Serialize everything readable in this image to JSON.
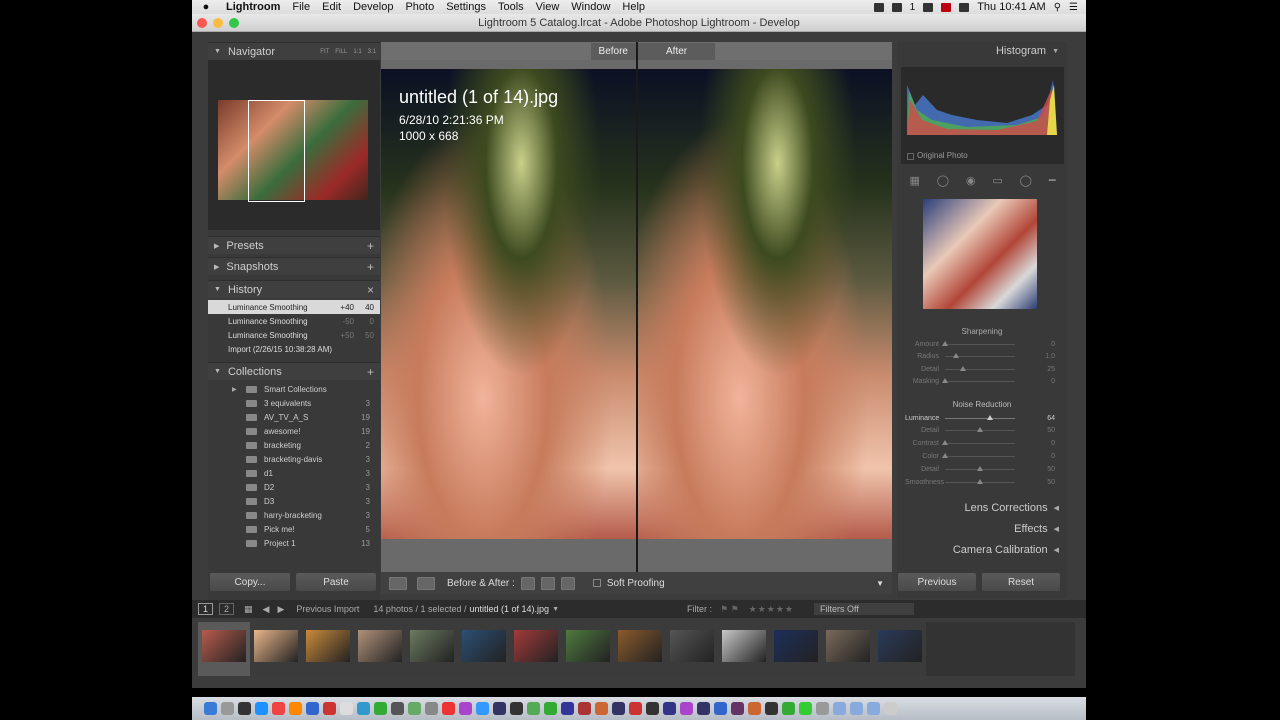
{
  "menubar": {
    "app": "Lightroom",
    "items": [
      "File",
      "Edit",
      "Develop",
      "Photo",
      "Settings",
      "Tools",
      "View",
      "Window",
      "Help"
    ],
    "clock": "Thu 10:41 AM",
    "badge": "1"
  },
  "window": {
    "title": "Lightroom 5 Catalog.lrcat - Adobe Photoshop Lightroom - Develop"
  },
  "left": {
    "navigator": {
      "title": "Navigator",
      "options": [
        "FIT",
        "FILL",
        "1:1",
        "3:1"
      ]
    },
    "presets": "Presets",
    "snapshots": "Snapshots",
    "history": {
      "title": "History",
      "items": [
        {
          "label": "Luminance Smoothing",
          "delta": "+40",
          "value": "40"
        },
        {
          "label": "Luminance Smoothing",
          "delta": "-50",
          "value": "0"
        },
        {
          "label": "Luminance Smoothing",
          "delta": "+50",
          "value": "50"
        },
        {
          "label": "Import (2/26/15 10:38:28 AM)",
          "delta": "",
          "value": ""
        }
      ]
    },
    "collections": {
      "title": "Collections",
      "items": [
        {
          "label": "Smart Collections",
          "count": ""
        },
        {
          "label": "3 equivalents",
          "count": "3"
        },
        {
          "label": "AV_TV_A_S",
          "count": "19"
        },
        {
          "label": "awesome!",
          "count": "19"
        },
        {
          "label": "bracketing",
          "count": "2"
        },
        {
          "label": "bracketing-davis",
          "count": "3"
        },
        {
          "label": "d1",
          "count": "3"
        },
        {
          "label": "D2",
          "count": "3"
        },
        {
          "label": "D3",
          "count": "3"
        },
        {
          "label": "harry-bracketing",
          "count": "3"
        },
        {
          "label": "Pick me!",
          "count": "5"
        },
        {
          "label": "Project 1",
          "count": "13"
        }
      ]
    },
    "copy": "Copy...",
    "paste": "Paste"
  },
  "center": {
    "before": "Before",
    "after": "After",
    "filename": "untitled (1 of 14).jpg",
    "date": "6/28/10 2:21:36 PM",
    "dims": "1000 x 668",
    "toolbar": {
      "mode": "Before & After :",
      "soft_proofing": "Soft Proofing"
    }
  },
  "right": {
    "histogram": "Histogram",
    "original_photo": "Original Photo",
    "sharpening": {
      "title": "Sharpening",
      "rows": [
        {
          "label": "Amount",
          "value": "0",
          "pos": 0.0
        },
        {
          "label": "Radius",
          "value": "1.0",
          "pos": 0.15
        },
        {
          "label": "Detail",
          "value": "25",
          "pos": 0.25
        },
        {
          "label": "Masking",
          "value": "0",
          "pos": 0.0
        }
      ]
    },
    "noise": {
      "title": "Noise Reduction",
      "rows": [
        {
          "label": "Luminance",
          "value": "64",
          "pos": 0.64,
          "active": true
        },
        {
          "label": "Detail",
          "value": "50",
          "pos": 0.5,
          "active": false
        },
        {
          "label": "Contrast",
          "value": "0",
          "pos": 0.0,
          "active": false
        },
        {
          "label": "Color",
          "value": "0",
          "pos": 0.0,
          "active": false
        },
        {
          "label": "Detail",
          "value": "50",
          "pos": 0.5,
          "active": false
        },
        {
          "label": "Smoothness",
          "value": "50",
          "pos": 0.5,
          "active": false
        }
      ]
    },
    "panels": [
      "Lens Corrections",
      "Effects",
      "Camera Calibration"
    ],
    "previous": "Previous",
    "reset": "Reset"
  },
  "filmstrip": {
    "pages": [
      "1",
      "2"
    ],
    "source": "Previous Import",
    "count": "14 photos / 1 selected /",
    "current": "untitled (1 of 14).jpg",
    "filter_label": "Filter :",
    "filter_value": "Filters Off"
  }
}
